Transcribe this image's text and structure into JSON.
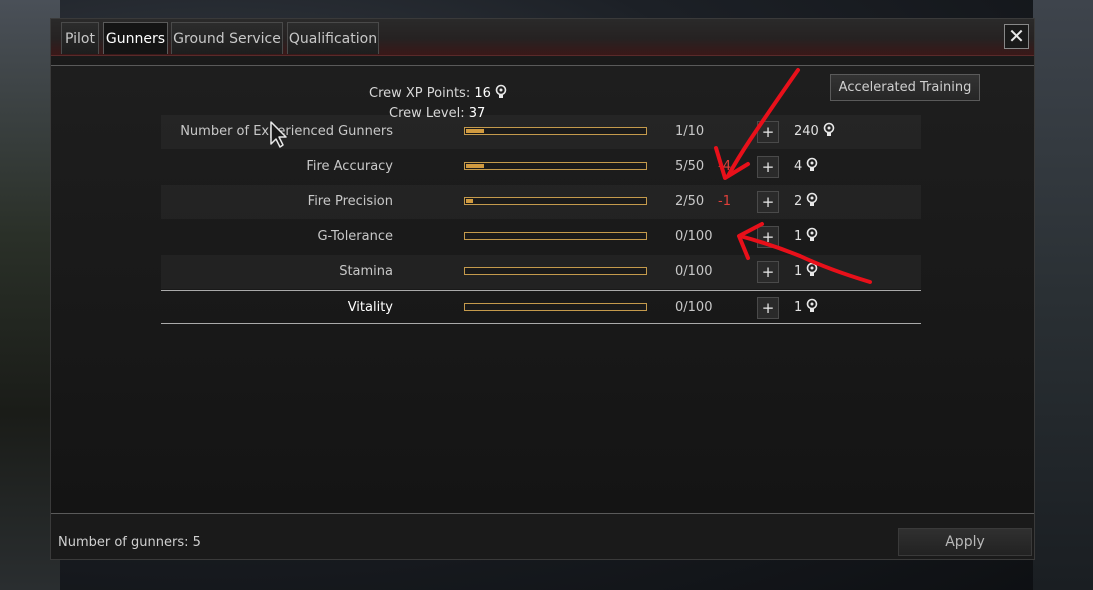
{
  "tabs": [
    {
      "label": "Pilot",
      "active": false
    },
    {
      "label": "Gunners",
      "active": true
    },
    {
      "label": "Ground Service",
      "active": false
    },
    {
      "label": "Qualification",
      "active": false
    }
  ],
  "close_label": "✕",
  "header": {
    "crew_xp_label": "Crew XP Points:",
    "crew_xp_value": "16",
    "crew_level_label": "Crew Level:",
    "crew_level_value": "37"
  },
  "accelerated_training_label": "Accelerated Training",
  "skills": [
    {
      "name": "Number of Experienced Gunners",
      "value": "1/10",
      "fill": 0.1,
      "delta": "",
      "cost": "240"
    },
    {
      "name": "Fire Accuracy",
      "value": "5/50",
      "fill": 0.1,
      "delta": "-4",
      "cost": "4"
    },
    {
      "name": "Fire Precision",
      "value": "2/50",
      "fill": 0.04,
      "delta": "-1",
      "cost": "2"
    },
    {
      "name": "G-Tolerance",
      "value": "0/100",
      "fill": 0,
      "delta": "",
      "cost": "1"
    },
    {
      "name": "Stamina",
      "value": "0/100",
      "fill": 0,
      "delta": "",
      "cost": "1"
    },
    {
      "name": "Vitality",
      "value": "0/100",
      "fill": 0,
      "delta": "",
      "cost": "1"
    }
  ],
  "plus_label": "+",
  "footer": {
    "gunners_text": "Number of gunners: 5",
    "apply_label": "Apply"
  },
  "colors": {
    "accent_red": "#e0403a",
    "bar_orange": "#d09a40",
    "annotation_red": "#e8101a"
  },
  "icons": {
    "xp": "lightbulb-icon",
    "close": "close-icon",
    "cursor": "mouse-cursor-icon"
  }
}
